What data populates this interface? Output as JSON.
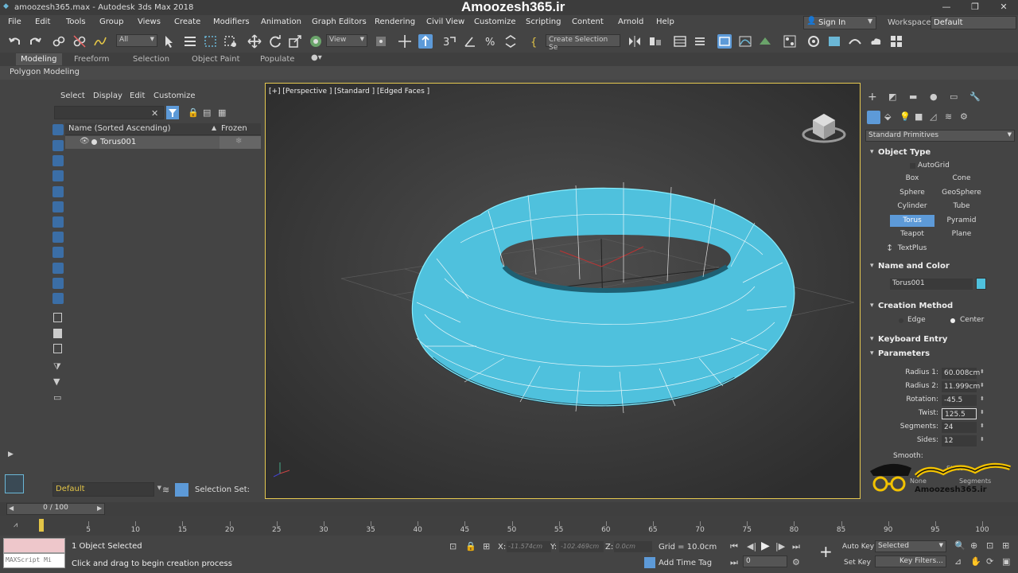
{
  "window": {
    "title": "amoozesh365.max - Autodesk 3ds Max 2018",
    "brand": "Amoozesh365.ir"
  },
  "menu": [
    "File",
    "Edit",
    "Tools",
    "Group",
    "Views",
    "Create",
    "Modifiers",
    "Animation",
    "Graph Editors",
    "Rendering",
    "Civil View",
    "Customize",
    "Scripting",
    "Content",
    "Arnold",
    "Help"
  ],
  "account": {
    "signin": "Sign In",
    "workspaces_label": "Workspaces:",
    "workspace": "Default"
  },
  "toolbar": {
    "selection_filter": "All",
    "ref_coord": "View",
    "create_selection_set": "Create Selection Se"
  },
  "ribbon": {
    "tabs": [
      "Modeling",
      "Freeform",
      "Selection",
      "Object Paint",
      "Populate"
    ],
    "active": "Modeling",
    "subpanel": "Polygon Modeling"
  },
  "scene_explorer": {
    "menus": [
      "Select",
      "Display",
      "Edit",
      "Customize"
    ],
    "col_name": "Name (Sorted Ascending)",
    "col_frozen": "Frozen",
    "rows": [
      {
        "name": "Torus001"
      }
    ],
    "layer": "Default",
    "selection_set_label": "Selection Set:"
  },
  "viewport": {
    "label": "[+] [Perspective ] [Standard ] [Edged Faces ]",
    "object_color": "#4fc1dd"
  },
  "command_panel": {
    "category": "Standard Primitives",
    "object_type": {
      "title": "Object Type",
      "autogrid": "AutoGrid",
      "buttons": [
        "Box",
        "Cone",
        "Sphere",
        "GeoSphere",
        "Cylinder",
        "Tube",
        "Torus",
        "Pyramid",
        "Teapot",
        "Plane",
        "TextPlus"
      ],
      "active": "Torus"
    },
    "name_color": {
      "title": "Name and Color",
      "name": "Torus001",
      "color": "#4fc1dd"
    },
    "creation_method": {
      "title": "Creation Method",
      "options": [
        "Edge",
        "Center"
      ],
      "selected": "Center"
    },
    "keyboard_entry": "Keyboard Entry",
    "parameters": {
      "title": "Parameters",
      "fields": [
        {
          "label": "Radius 1:",
          "value": "60.008cm"
        },
        {
          "label": "Radius 2:",
          "value": "11.999cm"
        },
        {
          "label": "Rotation:",
          "value": "-45.5"
        },
        {
          "label": "Twist:",
          "value": "125.5"
        },
        {
          "label": "Segments:",
          "value": "24"
        },
        {
          "label": "Sides:",
          "value": "12"
        }
      ],
      "smooth_label": "Smooth:",
      "smooth_options": [
        "None",
        "Sides",
        "Segments"
      ]
    },
    "watermark": "Amoozesh365.ir"
  },
  "timeline": {
    "frame": "0 / 100",
    "ticks": [
      5,
      10,
      15,
      20,
      25,
      30,
      35,
      40,
      45,
      50,
      55,
      60,
      65,
      70,
      75,
      80,
      85,
      90,
      95,
      100
    ]
  },
  "status": {
    "objects_selected": "1 Object Selected",
    "prompt": "Click and drag to begin creation process",
    "x_label": "X:",
    "x_value": "-11.574cm",
    "y_label": "Y:",
    "y_value": "-102.469cm",
    "z_label": "Z:",
    "z_value": "0.0cm",
    "grid": "Grid = 10.0cm",
    "add_time_tag": "Add Time Tag",
    "auto_key": "Auto Key",
    "set_key": "Set Key",
    "selected": "Selected",
    "key_filters": "Key Filters...",
    "frame_value": "0",
    "maxscript": "MAXScript Mi"
  }
}
